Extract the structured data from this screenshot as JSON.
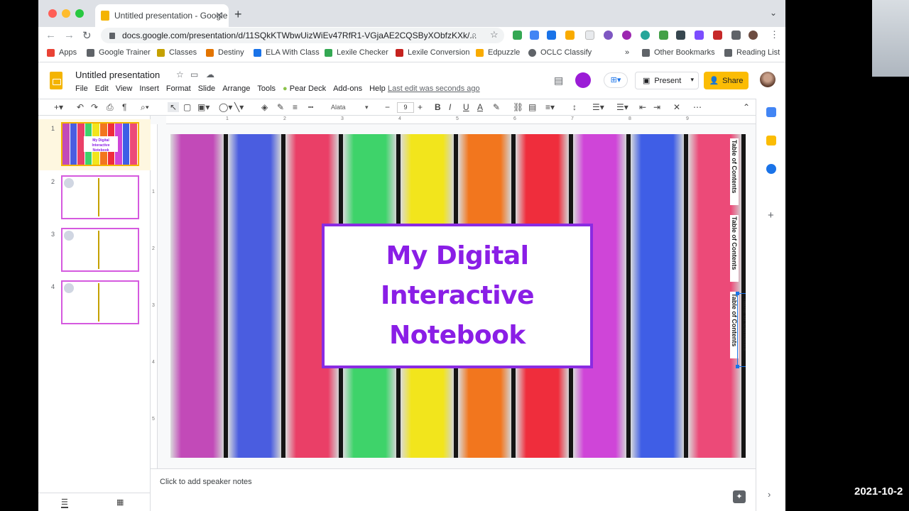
{
  "browser": {
    "tab_title": "Untitled presentation - Google",
    "tab_close": "✕",
    "new_tab": "+",
    "url": "docs.google.com/presentation/d/11SQkKTWbwUizWiEv47RfR1-VGjaAE2CQSByXObfzKXk/..."
  },
  "bookmarks": [
    {
      "label": "Apps",
      "color": "#e94235"
    },
    {
      "label": "Google Trainer",
      "color": "#5f6368"
    },
    {
      "label": "Classes",
      "color": "#c5a100"
    },
    {
      "label": "Destiny",
      "color": "#e37400"
    },
    {
      "label": "ELA With Class",
      "color": "#1a73e8"
    },
    {
      "label": "Lexile Checker",
      "color": "#34a853"
    },
    {
      "label": "Lexile Conversion",
      "color": "#c5221f"
    },
    {
      "label": "Edpuzzle",
      "color": "#f9ab00"
    },
    {
      "label": "OCLC Classify",
      "color": "#5f6368"
    }
  ],
  "bookmarks_more": "»",
  "other_bookmarks": "Other Bookmarks",
  "reading_list": "Reading List",
  "app": {
    "doc_title": "Untitled presentation",
    "menus": [
      "File",
      "Edit",
      "View",
      "Insert",
      "Format",
      "Slide",
      "Arrange",
      "Tools",
      "Pear Deck",
      "Add-ons",
      "Help"
    ],
    "last_edit": "Last edit was seconds ago",
    "present_label": "Present",
    "share_label": "Share"
  },
  "format_bar": {
    "font": "Alata",
    "font_size": "9"
  },
  "slides": [
    {
      "number": "1",
      "selected": true
    },
    {
      "number": "2",
      "selected": false
    },
    {
      "number": "3",
      "selected": false
    },
    {
      "number": "4",
      "selected": false
    }
  ],
  "slide": {
    "title_line1": "My Digital Interactive",
    "title_line2": "Notebook",
    "tab_label": "Table of Contents",
    "thumb_title": "My Digital Interactive Notebook",
    "plank_colors": [
      "#c24ab8",
      "#4a5de0",
      "#ea3f67",
      "#3ed36a",
      "#f2e51c",
      "#f2761e",
      "#ef2d3c",
      "#cf45d8",
      "#3f5ee6",
      "#ec4a78"
    ]
  },
  "ruler": {
    "top_ticks": [
      "1",
      "2",
      "3",
      "4",
      "5",
      "6",
      "7",
      "8",
      "9"
    ],
    "left_ticks": [
      "1",
      "2",
      "3",
      "4",
      "5"
    ]
  },
  "notes": {
    "placeholder": "Click to add speaker notes"
  },
  "overlay": {
    "timestamp": "2021-10-2"
  }
}
